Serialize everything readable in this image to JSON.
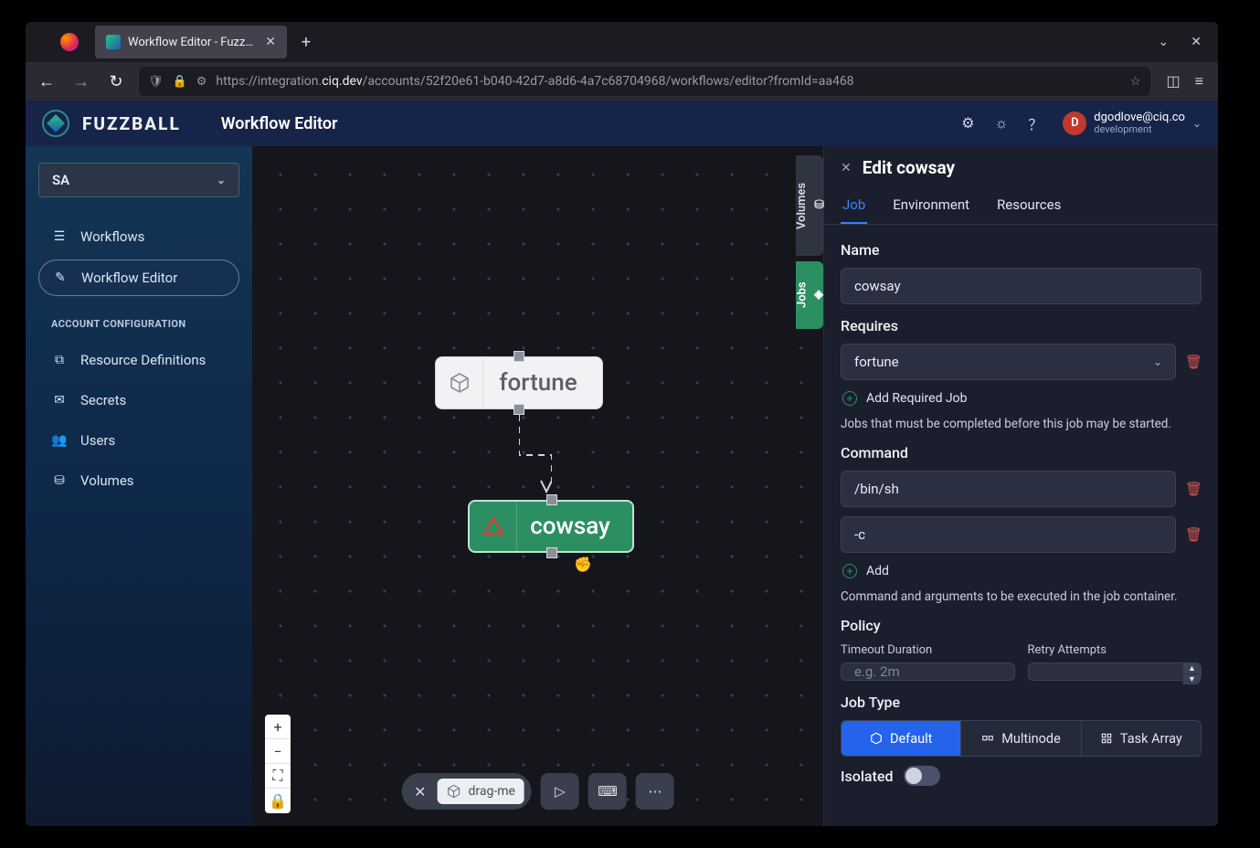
{
  "browser": {
    "tab_title": "Workflow Editor - Fuzzba",
    "url_display": "https://integration.",
    "url_bold": "ciq.dev",
    "url_tail": "/accounts/52f20e61-b040-42d7-a8d6-4a7c68704968/workflows/editor?fromId=aa468"
  },
  "app": {
    "logo": "FUZZBALL",
    "title": "Workflow Editor",
    "user_email": "dgodlove@ciq.co",
    "user_sub": "development",
    "avatar_letter": "D"
  },
  "sidebar": {
    "selector": "SA",
    "items": [
      {
        "label": "Workflows"
      },
      {
        "label": "Workflow Editor"
      },
      {
        "label": "Resource Definitions"
      },
      {
        "label": "Secrets"
      },
      {
        "label": "Users"
      },
      {
        "label": "Volumes"
      }
    ],
    "section_label": "ACCOUNT CONFIGURATION"
  },
  "canvas": {
    "nodes": {
      "fortune": "fortune",
      "cowsay": "cowsay"
    },
    "side_tabs": {
      "volumes": "Volumes",
      "jobs": "Jobs"
    },
    "drag_chip": "drag-me"
  },
  "panel": {
    "title": "Edit cowsay",
    "tabs": [
      "Job",
      "Environment",
      "Resources"
    ],
    "name_label": "Name",
    "name_value": "cowsay",
    "requires_label": "Requires",
    "requires_value": "fortune",
    "add_required": "Add Required Job",
    "requires_help": "Jobs that must be completed before this job may be started.",
    "command_label": "Command",
    "command_values": [
      "/bin/sh",
      "-c"
    ],
    "add_cmd": "Add",
    "command_help": "Command and arguments to be executed in the job container.",
    "policy_label": "Policy",
    "timeout_label": "Timeout Duration",
    "timeout_placeholder": "e.g. 2m",
    "retry_label": "Retry Attempts",
    "jobtype_label": "Job Type",
    "jobtype_options": [
      "Default",
      "Multinode",
      "Task Array"
    ],
    "isolated_label": "Isolated"
  }
}
